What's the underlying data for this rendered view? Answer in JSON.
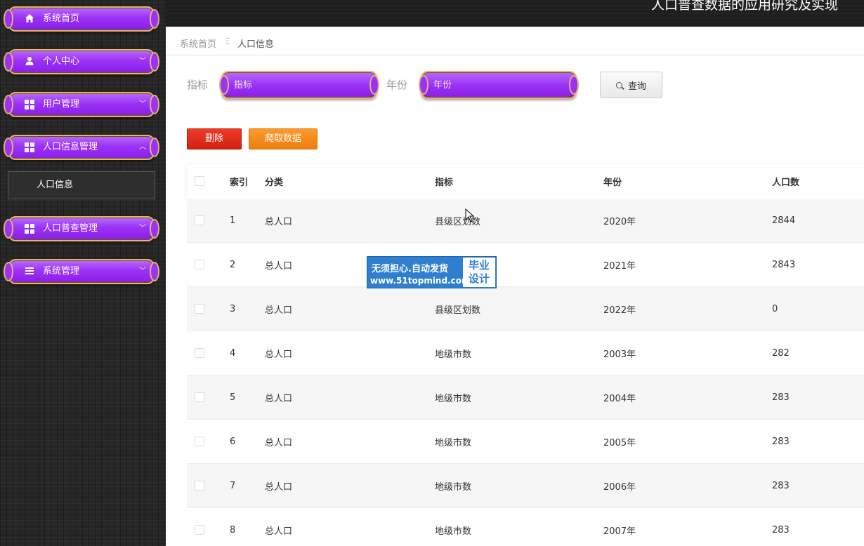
{
  "app": {
    "title": "人口普查数据的应用研究及实现"
  },
  "sidebar": {
    "items": [
      {
        "label": "系统首页",
        "icon": "home-icon",
        "arrow": ""
      },
      {
        "label": "个人中心",
        "icon": "user-icon",
        "arrow": "﹀"
      },
      {
        "label": "用户管理",
        "icon": "grid-icon",
        "arrow": "﹀"
      },
      {
        "label": "人口信息管理",
        "icon": "grid-icon",
        "arrow": "︿"
      },
      {
        "label": "人口普查管理",
        "icon": "grid-icon",
        "arrow": "﹀"
      },
      {
        "label": "系统管理",
        "icon": "list-icon",
        "arrow": "﹀"
      }
    ],
    "sub_items": [
      {
        "label": "人口信息"
      }
    ]
  },
  "breadcrumb": {
    "home": "系统首页",
    "separator": "Ξ",
    "current": "人口信息"
  },
  "search": {
    "indicator_label": "指标",
    "indicator_placeholder": "指标",
    "year_label": "年份",
    "year_placeholder": "年份",
    "query_button": "查询"
  },
  "actions": {
    "delete": "删除",
    "crawl": "爬取数据"
  },
  "table": {
    "headers": [
      "索引",
      "分类",
      "指标",
      "年份",
      "人口数"
    ],
    "rows": [
      [
        "1",
        "总人口",
        "县级区划数",
        "2020年",
        "2844"
      ],
      [
        "2",
        "总人口",
        "",
        "2021年",
        "2843"
      ],
      [
        "3",
        "总人口",
        "县级区划数",
        "2022年",
        "0"
      ],
      [
        "4",
        "总人口",
        "地级市数",
        "2003年",
        "282"
      ],
      [
        "5",
        "总人口",
        "地级市数",
        "2004年",
        "283"
      ],
      [
        "6",
        "总人口",
        "地级市数",
        "2005年",
        "283"
      ],
      [
        "7",
        "总人口",
        "地级市数",
        "2006年",
        "283"
      ],
      [
        "8",
        "总人口",
        "地级市数",
        "2007年",
        "283"
      ]
    ]
  },
  "watermark": {
    "line1": "无须担心.自动发货",
    "line2": "www.51topmind.com",
    "right_line1": "毕业",
    "right_line2": "设计"
  },
  "colors": {
    "menu_purple": "#9b32f5",
    "menu_border": "#e2b66b",
    "delete_red": "#e02a1a",
    "crawl_orange": "#f38a1c",
    "sidebar_bg": "#262626"
  }
}
